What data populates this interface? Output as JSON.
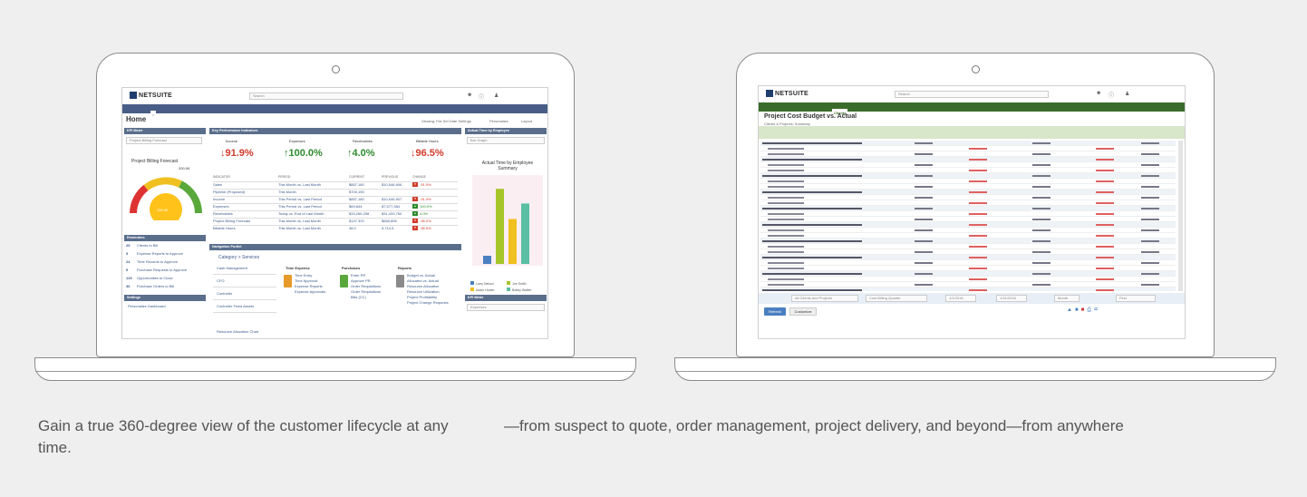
{
  "captions": {
    "left": "Gain a true 360-degree view of the customer lifecycle at any time.",
    "right": "—from suspect to quote, order management, project delivery, and beyond—from anywhere"
  },
  "colors": {
    "background": "#efefef",
    "nav_blue": "#485e86",
    "nav_green": "#3b6b2a",
    "kpi_red": "#d13a2a",
    "kpi_green": "#2e8a2e"
  },
  "left_screen": {
    "logo": "NETSUITE",
    "search_placeholder": "Search",
    "nav": [
      "Activities",
      "CRM",
      "PSA",
      "Time & Expenses",
      "Financials",
      "Documents",
      "Admin",
      "Support"
    ],
    "page_title": "Home",
    "header_right": [
      "Viewing: Pre-Set Date Settings",
      "Personalize",
      "Layout"
    ],
    "kpi_meter": {
      "header": "KPI Meter",
      "select": "Project Billing Forecast",
      "title": "Project Billing Forecast",
      "value_label": "200.0K",
      "center_value": "150.0K"
    },
    "kpi_panel": {
      "header": "Key Performance Indicators",
      "labels": [
        "Income",
        "Expenses",
        "Receivables",
        "Billable Hours"
      ],
      "values": [
        "91.9%",
        "100.0%",
        "4.0%",
        "96.5%"
      ],
      "directions": [
        "down",
        "up",
        "up",
        "down"
      ],
      "table_headers": [
        "INDICATOR",
        "PERIOD",
        "CURRENT",
        "PREVIOUS",
        "CHANGE"
      ],
      "rows": [
        {
          "name": "Sales",
          "period": "This Month vs. Last Month",
          "current": "$857,180",
          "previous": "$10,546,906",
          "change": "-91.9%",
          "dir": "down"
        },
        {
          "name": "Pipeline (Proposed)",
          "period": "This Month",
          "current": "$709,155",
          "previous": "",
          "change": "",
          "dir": ""
        },
        {
          "name": "Income",
          "period": "This Period vs. Last Period",
          "current": "$857,180",
          "previous": "$10,546,907",
          "change": "-91.9%",
          "dir": "down"
        },
        {
          "name": "Expenses",
          "period": "This Period vs. Last Period",
          "current": "$69,844",
          "previous": "$7,577,384",
          "change": "100.0%",
          "dir": "up"
        },
        {
          "name": "Receivables",
          "period": "Today vs. End of Last Month",
          "current": "$33,266,298",
          "previous": "$31,433,750",
          "change": "4.0%",
          "dir": "up"
        },
        {
          "name": "Project Billing Forecast",
          "period": "This Month vs. Last Month",
          "current": "$147,320",
          "previous": "$665,806",
          "change": "-96.0%",
          "dir": "down"
        },
        {
          "name": "Billable Hours",
          "period": "This Month vs. Last Month",
          "current": "46.0",
          "previous": "5,714.5",
          "change": "-96.5%",
          "dir": "down"
        }
      ]
    },
    "actual_time": {
      "header": "Actual Time by Employee",
      "select": "Bar Graph",
      "title": "Actual Time by Employee Summary",
      "bar_values": [
        10,
        92,
        55,
        74
      ],
      "legend": [
        "Larry Nelson",
        "Joe Smith",
        "Adam Hunter",
        "Bobby Walker"
      ]
    },
    "reminders": {
      "header": "Reminders",
      "items": [
        {
          "count": "25",
          "label": "Clients to Bill"
        },
        {
          "count": "9",
          "label": "Expense Reports to Approve"
        },
        {
          "count": "24",
          "label": "Time Records to Approve"
        },
        {
          "count": "5",
          "label": "Purchase Requests to Approve"
        },
        {
          "count": "126",
          "label": "Opportunities to Close"
        },
        {
          "count": "36",
          "label": "Purchase Orders to Bill"
        }
      ]
    },
    "settings_header": "Settings",
    "settings_item": "Personalize Dashboard",
    "navigation": {
      "header": "Navigation Portlet",
      "breadcrumb": "Category > Services",
      "left_items": [
        "Cash Management",
        "CFO",
        "Controller",
        "Controller Fixed Assets"
      ],
      "link": "Resource Allocation Chart",
      "col_titles": [
        "Time Expense",
        "Purchases",
        "Reports"
      ],
      "time_expense": [
        "Time Entry",
        "Time Approval",
        "Expense Reports",
        "Expense Approvals"
      ],
      "purchases": [
        "Enter PR",
        "Approve PR",
        "Order Requisitions",
        "Order Requisitions",
        "Bills (CC)"
      ],
      "reports": [
        "Budget vs. Actual",
        "Allocated vs. Actual",
        "Resource Allocation",
        "Resource Utilization",
        "Project Profitability",
        "Project Change Requests"
      ]
    },
    "kpi_meter_2": {
      "header": "KPI Meter",
      "select": "Expenses"
    }
  },
  "right_screen": {
    "logo": "NETSUITE",
    "search_placeholder": "Search",
    "nav": [
      "Activities",
      "Billing",
      "Clients",
      "Vendors",
      "Payroll and HR",
      "Financial",
      "Reports",
      "Documents",
      "Setup",
      "Payments",
      "Fixed Assets",
      "Statistical Analysis",
      "Support"
    ],
    "title": "Project Cost Budget vs. Actual",
    "subtitle": "Clients & Projects: Summary",
    "filter_labels": [
      "Customer",
      "Project",
      "Period",
      "Column"
    ],
    "filter_values": [
      "All Clients and Projects",
      "Cost Billing Quarter",
      "1/1/2016",
      "1/31/2016",
      "Month",
      "Find"
    ],
    "buttons": [
      "Refresh",
      "Customize"
    ]
  }
}
